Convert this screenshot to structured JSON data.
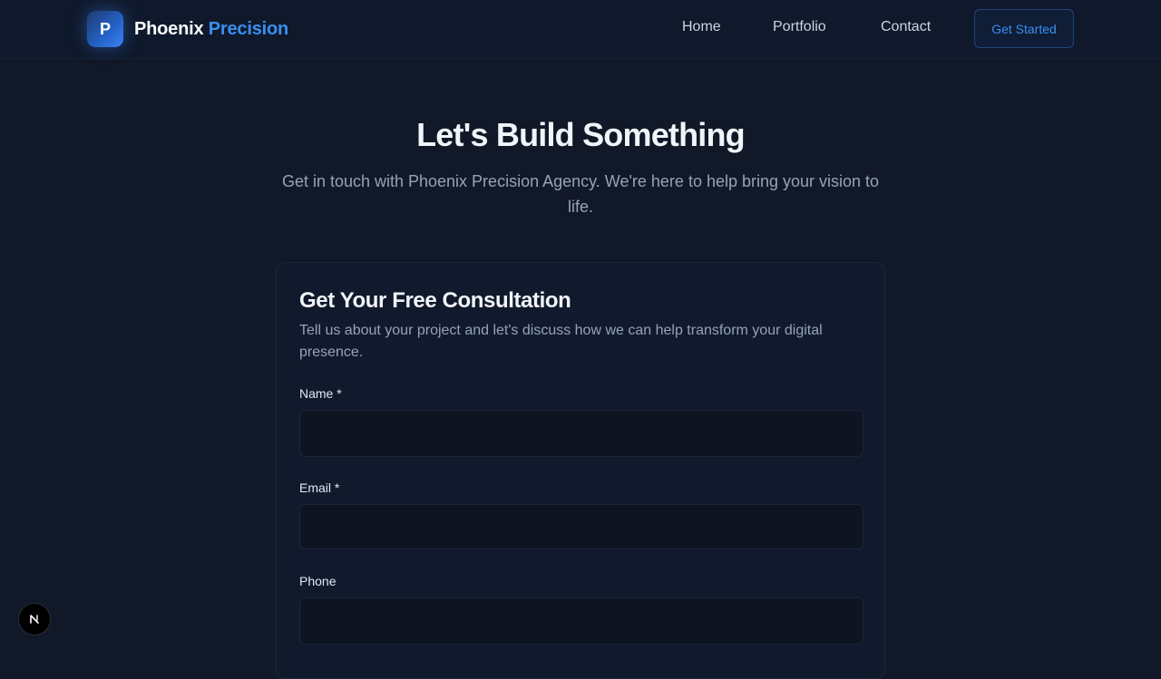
{
  "nav": {
    "logo_letter": "P",
    "brand_primary": "Phoenix",
    "brand_accent": "Precision",
    "links": [
      {
        "label": "Home"
      },
      {
        "label": "Portfolio"
      },
      {
        "label": "Contact"
      }
    ],
    "cta_label": "Get Started"
  },
  "hero": {
    "title": "Let's Build Something",
    "subtitle": "Get in touch with Phoenix Precision Agency. We're here to help bring your vision to life."
  },
  "form": {
    "title": "Get Your Free Consultation",
    "description": "Tell us about your project and let's discuss how we can help transform your digital presence.",
    "fields": [
      {
        "label": "Name *",
        "value": "",
        "placeholder": ""
      },
      {
        "label": "Email *",
        "value": "",
        "placeholder": ""
      },
      {
        "label": "Phone",
        "value": "",
        "placeholder": ""
      }
    ]
  },
  "floating_button": {
    "icon": "nextjs-logo-icon"
  },
  "colors": {
    "background": "#111827",
    "navbar": "#0f192b",
    "accent": "#3b8ef0",
    "card": "#111a2c",
    "input": "#0e1422",
    "muted_text": "#94a3b8"
  }
}
